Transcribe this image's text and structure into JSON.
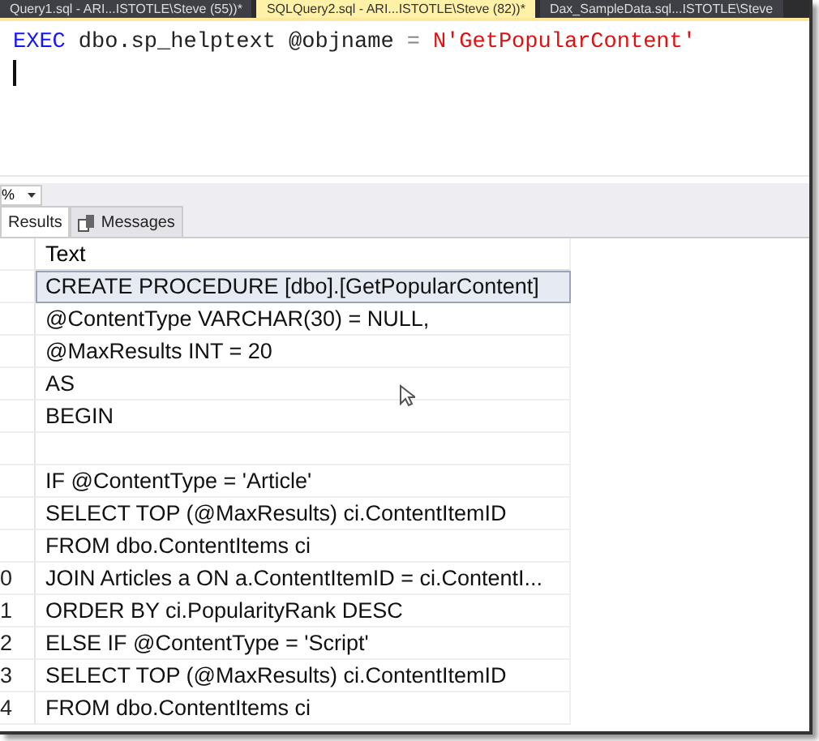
{
  "doc_tabs": [
    {
      "label": "Query1.sql - ARI...ISTOTLE\\Steve (55))*",
      "selected": false
    },
    {
      "label": "SQLQuery2.sql - ARI...ISTOTLE\\Steve (82))*",
      "selected": true
    },
    {
      "label": "Dax_SampleData.sql...ISTOTLE\\Steve",
      "selected": false
    }
  ],
  "editor": {
    "tokens": [
      {
        "text": "EXEC",
        "kind": "keyword"
      },
      {
        "text": "dbo.sp_helptext @objname",
        "kind": "plain"
      },
      {
        "text": "=",
        "kind": "operator"
      },
      {
        "text": "N'GetPopularContent'",
        "kind": "string"
      }
    ]
  },
  "zoom": {
    "value": "%"
  },
  "result_tabs": [
    {
      "label": "Results",
      "selected": true
    },
    {
      "label": "Messages",
      "selected": false
    }
  ],
  "grid": {
    "columns": [
      "Text"
    ],
    "rows": [
      {
        "row_number": "",
        "text": "CREATE PROCEDURE [dbo].[GetPopularContent]",
        "selected": true
      },
      {
        "row_number": "",
        "text": "@ContentType VARCHAR(30) = NULL,",
        "selected": false
      },
      {
        "row_number": "",
        "text": "@MaxResults  INT = 20",
        "selected": false
      },
      {
        "row_number": "",
        "text": "AS",
        "selected": false
      },
      {
        "row_number": "",
        "text": "BEGIN",
        "selected": false
      },
      {
        "row_number": "",
        "text": "",
        "selected": false
      },
      {
        "row_number": "",
        "text": "IF @ContentType = 'Article'",
        "selected": false
      },
      {
        "row_number": "",
        "text": " SELECT TOP (@MaxResults) ci.ContentItemID",
        "selected": false
      },
      {
        "row_number": "",
        "text": " FROM dbo.ContentItems ci",
        "selected": false
      },
      {
        "row_number": "0",
        "text": " JOIN Articles a ON a.ContentItemID = ci.ContentI...",
        "selected": false
      },
      {
        "row_number": "1",
        "text": " ORDER BY ci.PopularityRank DESC",
        "selected": false
      },
      {
        "row_number": "2",
        "text": "ELSE IF @ContentType = 'Script'",
        "selected": false
      },
      {
        "row_number": "3",
        "text": " SELECT TOP (@MaxResults) ci.ContentItemID",
        "selected": false
      },
      {
        "row_number": "4",
        "text": " FROM dbo.ContentItems ci",
        "selected": false
      }
    ]
  }
}
